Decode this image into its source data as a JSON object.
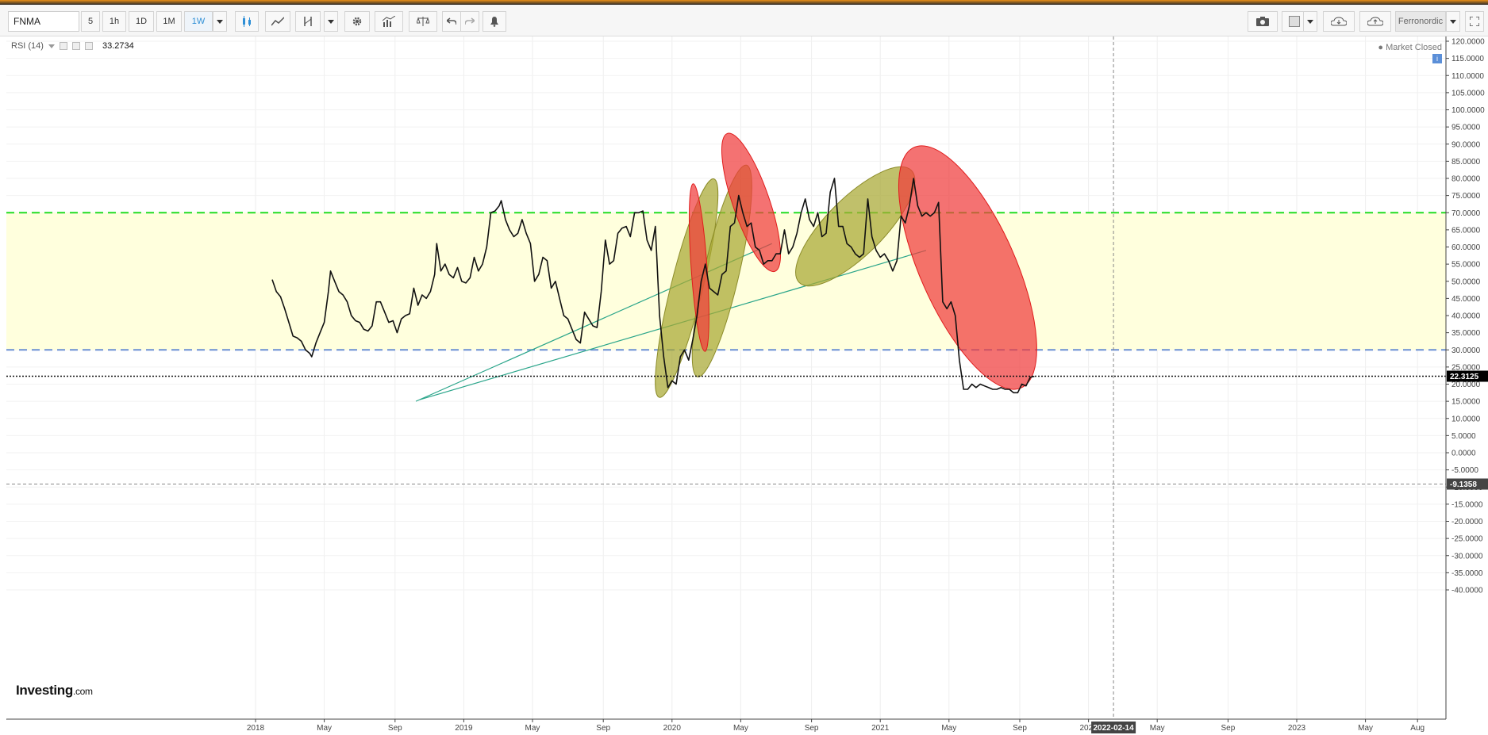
{
  "toolbar": {
    "symbol": "FNMA",
    "intervals": [
      "5",
      "1h",
      "1D",
      "1M",
      "1W"
    ],
    "active_interval": "1W",
    "account_label": "Ferronordic"
  },
  "indicator": {
    "name": "RSI (14)",
    "value": "33.2734"
  },
  "market_status": "Market Closed",
  "brand": {
    "name": "Investing",
    "suffix": ".com"
  },
  "crosshair": {
    "date_label": "2022-02-14",
    "price_label": "-9.1358"
  },
  "last_value_label": "22.3125",
  "colors": {
    "rsi_line": "#111111",
    "overbought": "#22dd22",
    "oversold": "#6a8fd4",
    "band_fill": "#ffffdd",
    "red_marker": "#f03c3c",
    "olive_marker": "#a8a832",
    "trendline": "#2aa58a"
  },
  "chart_data": {
    "type": "line",
    "title": "",
    "ylim": [
      -40,
      120
    ],
    "yticks": [
      "120.0000",
      "115.0000",
      "110.0000",
      "105.0000",
      "100.0000",
      "95.0000",
      "90.0000",
      "85.0000",
      "80.0000",
      "75.0000",
      "70.0000",
      "65.0000",
      "60.0000",
      "55.0000",
      "50.0000",
      "45.0000",
      "40.0000",
      "35.0000",
      "30.0000",
      "25.0000",
      "20.0000",
      "15.0000",
      "10.0000",
      "5.0000",
      "0.0000",
      "-5.0000",
      "-10.0000",
      "-15.0000",
      "-20.0000",
      "-25.0000",
      "-30.0000",
      "-35.0000",
      "-40.0000"
    ],
    "xticks": [
      {
        "label": "2018",
        "t": 2018.0
      },
      {
        "label": "May",
        "t": 2018.33
      },
      {
        "label": "Sep",
        "t": 2018.67
      },
      {
        "label": "2019",
        "t": 2019.0
      },
      {
        "label": "May",
        "t": 2019.33
      },
      {
        "label": "Sep",
        "t": 2019.67
      },
      {
        "label": "2020",
        "t": 2020.0
      },
      {
        "label": "May",
        "t": 2020.33
      },
      {
        "label": "Sep",
        "t": 2020.67
      },
      {
        "label": "2021",
        "t": 2021.0
      },
      {
        "label": "May",
        "t": 2021.33
      },
      {
        "label": "Sep",
        "t": 2021.67
      },
      {
        "label": "2022",
        "t": 2022.0
      },
      {
        "label": "May",
        "t": 2022.33
      },
      {
        "label": "Sep",
        "t": 2022.67
      },
      {
        "label": "2023",
        "t": 2023.0
      },
      {
        "label": "May",
        "t": 2023.33
      },
      {
        "label": "Aug",
        "t": 2023.58
      }
    ],
    "xlim": [
      2016.83,
      2023.66
    ],
    "overbought": 70,
    "oversold": 30,
    "last_value": 22.3125,
    "crosshair_value": -9.1358,
    "crosshair_t": 2022.12,
    "series": [
      {
        "values": [
          [
            2018.08,
            50.5
          ],
          [
            2018.1,
            47
          ],
          [
            2018.12,
            45.5
          ],
          [
            2018.14,
            42
          ],
          [
            2018.16,
            38
          ],
          [
            2018.18,
            34
          ],
          [
            2018.2,
            33.5
          ],
          [
            2018.22,
            32.5
          ],
          [
            2018.24,
            30
          ],
          [
            2018.26,
            29
          ],
          [
            2018.27,
            28
          ],
          [
            2018.29,
            32
          ],
          [
            2018.31,
            35
          ],
          [
            2018.33,
            38
          ],
          [
            2018.35,
            47
          ],
          [
            2018.36,
            53
          ],
          [
            2018.38,
            50
          ],
          [
            2018.4,
            47
          ],
          [
            2018.42,
            46
          ],
          [
            2018.44,
            44
          ],
          [
            2018.46,
            40
          ],
          [
            2018.48,
            38.5
          ],
          [
            2018.5,
            38
          ],
          [
            2018.52,
            36
          ],
          [
            2018.54,
            35.5
          ],
          [
            2018.56,
            37
          ],
          [
            2018.58,
            44
          ],
          [
            2018.6,
            44
          ],
          [
            2018.62,
            41
          ],
          [
            2018.64,
            38
          ],
          [
            2018.66,
            38.5
          ],
          [
            2018.68,
            35
          ],
          [
            2018.7,
            39
          ],
          [
            2018.72,
            40
          ],
          [
            2018.74,
            40.5
          ],
          [
            2018.76,
            48
          ],
          [
            2018.78,
            43
          ],
          [
            2018.8,
            46
          ],
          [
            2018.82,
            45
          ],
          [
            2018.84,
            47
          ],
          [
            2018.86,
            52
          ],
          [
            2018.87,
            61
          ],
          [
            2018.89,
            53
          ],
          [
            2018.91,
            55
          ],
          [
            2018.93,
            52
          ],
          [
            2018.95,
            51
          ],
          [
            2018.97,
            54
          ],
          [
            2018.99,
            50
          ],
          [
            2019.01,
            49.5
          ],
          [
            2019.03,
            51
          ],
          [
            2019.05,
            57
          ],
          [
            2019.07,
            53
          ],
          [
            2019.09,
            55
          ],
          [
            2019.11,
            60
          ],
          [
            2019.13,
            70
          ],
          [
            2019.15,
            70.5
          ],
          [
            2019.17,
            72
          ],
          [
            2019.18,
            73.5
          ],
          [
            2019.2,
            68
          ],
          [
            2019.22,
            65
          ],
          [
            2019.24,
            63
          ],
          [
            2019.26,
            64
          ],
          [
            2019.28,
            68
          ],
          [
            2019.3,
            64
          ],
          [
            2019.32,
            61
          ],
          [
            2019.34,
            50
          ],
          [
            2019.36,
            52
          ],
          [
            2019.38,
            57
          ],
          [
            2019.4,
            56
          ],
          [
            2019.42,
            48
          ],
          [
            2019.44,
            50
          ],
          [
            2019.46,
            45
          ],
          [
            2019.48,
            40
          ],
          [
            2019.5,
            39
          ],
          [
            2019.52,
            36
          ],
          [
            2019.54,
            33
          ],
          [
            2019.56,
            32
          ],
          [
            2019.58,
            41
          ],
          [
            2019.6,
            39
          ],
          [
            2019.62,
            37
          ],
          [
            2019.64,
            36.5
          ],
          [
            2019.66,
            47
          ],
          [
            2019.68,
            62
          ],
          [
            2019.7,
            55
          ],
          [
            2019.72,
            56
          ],
          [
            2019.74,
            64
          ],
          [
            2019.76,
            65.5
          ],
          [
            2019.78,
            66
          ],
          [
            2019.8,
            63
          ],
          [
            2019.82,
            70
          ],
          [
            2019.84,
            70
          ],
          [
            2019.86,
            70.5
          ],
          [
            2019.88,
            62
          ],
          [
            2019.9,
            59
          ],
          [
            2019.92,
            66
          ],
          [
            2019.94,
            40
          ],
          [
            2019.96,
            28
          ],
          [
            2019.98,
            19
          ],
          [
            2020.0,
            21
          ],
          [
            2020.02,
            20
          ],
          [
            2020.04,
            28
          ],
          [
            2020.06,
            30
          ],
          [
            2020.08,
            27
          ],
          [
            2020.1,
            33
          ],
          [
            2020.12,
            40
          ],
          [
            2020.14,
            50
          ],
          [
            2020.16,
            55
          ],
          [
            2020.18,
            48
          ],
          [
            2020.2,
            47
          ],
          [
            2020.22,
            46
          ],
          [
            2020.24,
            52
          ],
          [
            2020.26,
            53
          ],
          [
            2020.28,
            66
          ],
          [
            2020.3,
            67
          ],
          [
            2020.32,
            75
          ],
          [
            2020.34,
            70
          ],
          [
            2020.36,
            66
          ],
          [
            2020.38,
            67
          ],
          [
            2020.4,
            60
          ],
          [
            2020.42,
            59
          ],
          [
            2020.44,
            55
          ],
          [
            2020.46,
            56
          ],
          [
            2020.48,
            56
          ],
          [
            2020.5,
            58
          ],
          [
            2020.52,
            58
          ],
          [
            2020.54,
            65
          ],
          [
            2020.56,
            58
          ],
          [
            2020.58,
            60
          ],
          [
            2020.6,
            64
          ],
          [
            2020.62,
            70
          ],
          [
            2020.64,
            74
          ],
          [
            2020.66,
            68
          ],
          [
            2020.68,
            66
          ],
          [
            2020.7,
            70
          ],
          [
            2020.72,
            63
          ],
          [
            2020.74,
            64
          ],
          [
            2020.76,
            76
          ],
          [
            2020.78,
            80
          ],
          [
            2020.8,
            66
          ],
          [
            2020.82,
            66
          ],
          [
            2020.84,
            61
          ],
          [
            2020.86,
            60
          ],
          [
            2020.88,
            58
          ],
          [
            2020.9,
            57
          ],
          [
            2020.92,
            58
          ],
          [
            2020.94,
            74
          ],
          [
            2020.96,
            63
          ],
          [
            2020.98,
            59
          ],
          [
            2021.0,
            57
          ],
          [
            2021.02,
            58
          ],
          [
            2021.04,
            56
          ],
          [
            2021.06,
            53
          ],
          [
            2021.08,
            56
          ],
          [
            2021.1,
            69
          ],
          [
            2021.12,
            67
          ],
          [
            2021.14,
            72
          ],
          [
            2021.16,
            80
          ],
          [
            2021.18,
            72
          ],
          [
            2021.2,
            69
          ],
          [
            2021.22,
            70
          ],
          [
            2021.24,
            69
          ],
          [
            2021.26,
            70
          ],
          [
            2021.28,
            73
          ],
          [
            2021.3,
            44
          ],
          [
            2021.32,
            42
          ],
          [
            2021.34,
            44
          ],
          [
            2021.36,
            40
          ],
          [
            2021.38,
            27
          ],
          [
            2021.4,
            18.5
          ],
          [
            2021.42,
            18.5
          ],
          [
            2021.44,
            20
          ],
          [
            2021.46,
            19
          ],
          [
            2021.48,
            20
          ],
          [
            2021.5,
            19.5
          ],
          [
            2021.52,
            19
          ],
          [
            2021.54,
            18.5
          ],
          [
            2021.56,
            18.5
          ],
          [
            2021.58,
            19
          ],
          [
            2021.6,
            18.5
          ],
          [
            2021.62,
            18.5
          ],
          [
            2021.64,
            17.5
          ],
          [
            2021.66,
            17.5
          ],
          [
            2021.68,
            20
          ],
          [
            2021.7,
            19.5
          ],
          [
            2021.72,
            22
          ],
          [
            2021.74,
            22.3
          ]
        ]
      }
    ]
  }
}
